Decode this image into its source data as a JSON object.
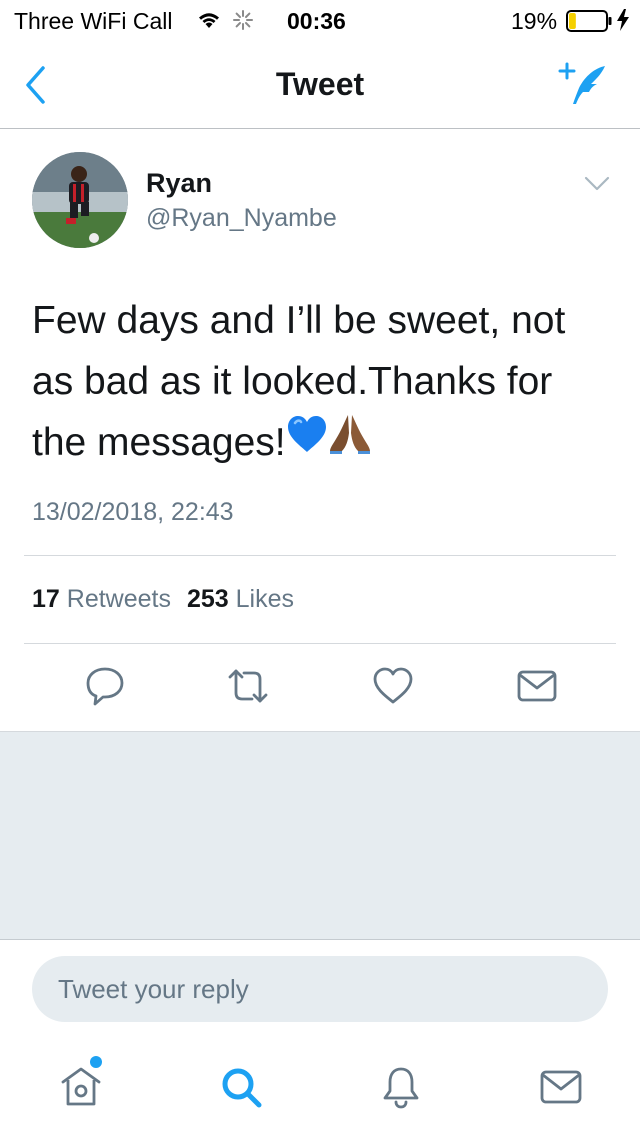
{
  "status_bar": {
    "carrier": "Three WiFi Call",
    "time": "00:36",
    "battery_percent": "19%",
    "battery_level": 0.19,
    "icons": [
      "wifi-icon",
      "spinner-icon",
      "battery-icon",
      "charging-bolt-icon"
    ]
  },
  "nav": {
    "title": "Tweet",
    "back_icon": "chevron-left-icon",
    "compose_icon": "compose-tweet-icon"
  },
  "tweet": {
    "name": "Ryan",
    "handle": "@Ryan_Nyambe",
    "text": "Few days and I’ll be sweet, not as bad as it looked.Thanks for the messages!",
    "emojis": [
      "blue-heart-emoji",
      "folded-hands-emoji"
    ],
    "timestamp": "13/02/2018, 22:43",
    "retweets_count": "17",
    "retweets_label": "Retweets",
    "likes_count": "253",
    "likes_label": "Likes"
  },
  "actions": [
    "reply-icon",
    "retweet-icon",
    "like-icon",
    "share-dm-icon"
  ],
  "reply": {
    "placeholder": "Tweet your reply"
  },
  "tabs": [
    "home-icon",
    "search-icon",
    "notifications-icon",
    "messages-icon"
  ],
  "colors": {
    "accent": "#1da1f2",
    "text_primary": "#14171a",
    "text_secondary": "#657786",
    "background_gray": "#e6ecf0",
    "battery_fill": "#f5d000"
  }
}
